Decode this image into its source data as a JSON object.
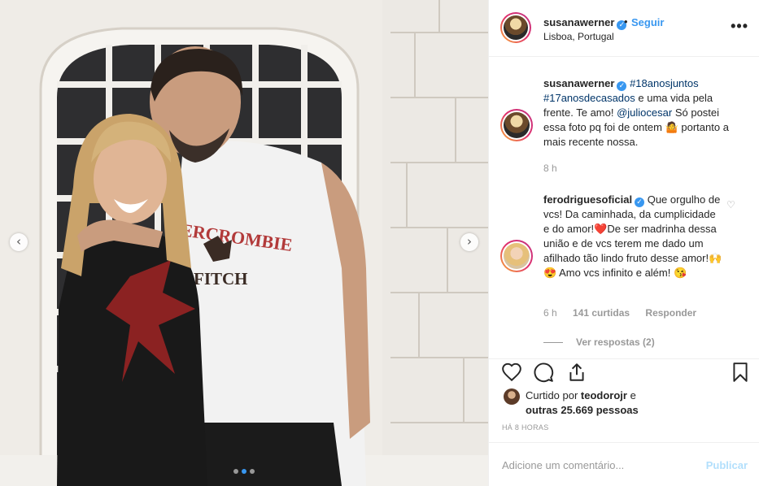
{
  "colors": {
    "accent": "#3897f0",
    "link": "#003569",
    "muted": "#999999",
    "text": "#262626",
    "publish_disabled": "#b2dffc"
  },
  "photo": {
    "shirt_text_line1": "ERCROMBIE",
    "shirt_text_line2": "FITCH",
    "carousel_dots": 3,
    "active_dot": 1,
    "prev_icon": "chevron-left-icon",
    "next_icon": "chevron-right-icon"
  },
  "header": {
    "username": "susanawerner",
    "verified_icon": "verified-badge-icon",
    "separator": "•",
    "follow_label": "Seguir",
    "location": "Lisboa, Portugal",
    "more_label": "•••"
  },
  "caption": {
    "username": "susanawerner",
    "hashtag1": "#18anosjuntos",
    "hashtag2": "#17anosdecasados",
    "text1": " e uma vida pela frente. Te amo! ",
    "mention": "@juliocesar",
    "text2": " Só postei essa foto pq foi de ontem 🤷 portanto a mais recente nossa.",
    "time": "8 h"
  },
  "comment": {
    "username": "ferodriguesoficial",
    "text": "Que orgulho de vcs! Da caminhada, da cumplicidade e do amor!❤️De ser madrinha dessa união e de vcs terem me dado um afilhado tão lindo fruto desse amor!🙌 😍 Amo vcs infinito e além! 😘",
    "time": "6 h",
    "likes": "141 curtidas",
    "reply": "Responder",
    "view_replies": "Ver respostas (2)",
    "like_icon": "heart-outline-icon"
  },
  "actions": {
    "like_icon": "heart-icon",
    "comment_icon": "comment-icon",
    "share_icon": "share-icon",
    "save_icon": "bookmark-icon",
    "liked_prefix": "Curtido por ",
    "liked_user": "teodorojr",
    "liked_mid": " e",
    "liked_others": "outras 25.669 pessoas",
    "timestamp": "HÁ 8 HORAS"
  },
  "add_comment": {
    "placeholder": "Adicione um comentário...",
    "publish_label": "Publicar"
  }
}
